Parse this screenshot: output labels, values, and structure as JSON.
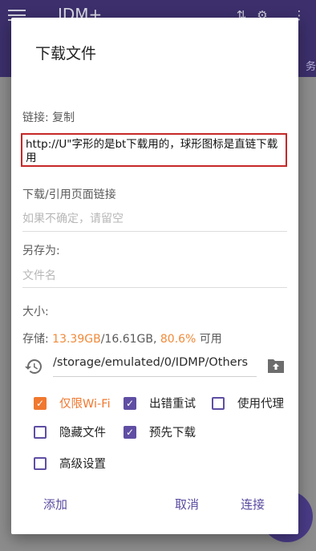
{
  "background_app": {
    "title": "IDM+",
    "side_text": "务"
  },
  "dialog": {
    "title": "下载文件",
    "link_label": "链接: 复制",
    "url_value": "http://U\"字形的是bt下载用的，球形图标是直链下载用",
    "referer_label": "下载/引用页面链接",
    "referer_hint": "如果不确定，请留空",
    "save_as_label": "另存为:",
    "filename_hint": "文件名",
    "size_label": "大小:",
    "storage": {
      "prefix": "存储: ",
      "free": "13.39GB",
      "total": "/16.61GB, ",
      "percent": "80.6%",
      "suffix": " 可用"
    },
    "path": "/storage/emulated/0/IDMP/Others",
    "options": {
      "wifi_only": {
        "label": "仅限Wi-Fi",
        "checked": true
      },
      "retry_on_error": {
        "label": "出错重试",
        "checked": true
      },
      "use_proxy": {
        "label": "使用代理",
        "checked": false
      },
      "hidden_file": {
        "label": "隐藏文件",
        "checked": false
      },
      "pre_download": {
        "label": "预先下载",
        "checked": true
      },
      "advanced": {
        "label": "高级设置",
        "checked": false
      }
    },
    "buttons": {
      "add": "添加",
      "cancel": "取消",
      "connect": "连接"
    }
  },
  "colors": {
    "accent": "#5f4ea3",
    "orange": "#f0782f",
    "highlight_border": "#c62828",
    "appbar": "#3c2f6b"
  }
}
